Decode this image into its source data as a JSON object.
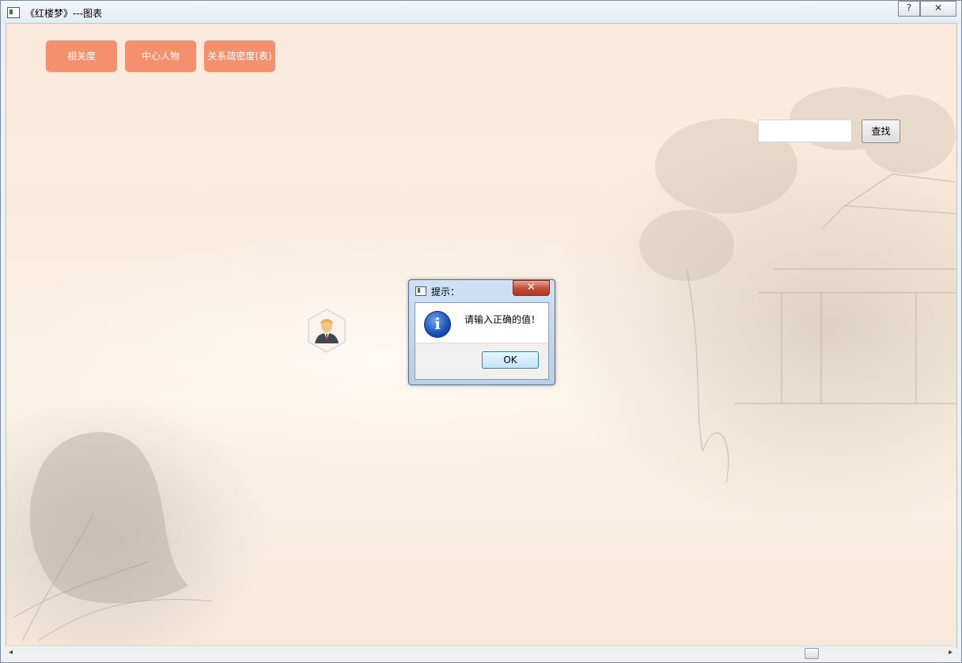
{
  "window": {
    "title": "《红楼梦》---图表",
    "help_label": "?",
    "close_label": "✕"
  },
  "toolbar": {
    "buttons": [
      "相关度",
      "中心人物",
      "关系疏密度(表)"
    ]
  },
  "search": {
    "value": "",
    "placeholder": "",
    "button_label": "查找"
  },
  "dialog": {
    "title": "提示：",
    "close_label": "✕",
    "icon": "info-icon",
    "icon_glyph": "i",
    "message": "请输入正确的值！",
    "ok_label": "OK"
  },
  "graph": {
    "nodes": [
      {
        "icon": "person-avatar-icon"
      }
    ]
  },
  "scrollbar": {
    "left_arrow": "◂",
    "right_arrow": "▸"
  },
  "colors": {
    "nav_button": "#f5906f",
    "dialog_frame": "#b9cfe8",
    "close_button": "#c54b35"
  }
}
